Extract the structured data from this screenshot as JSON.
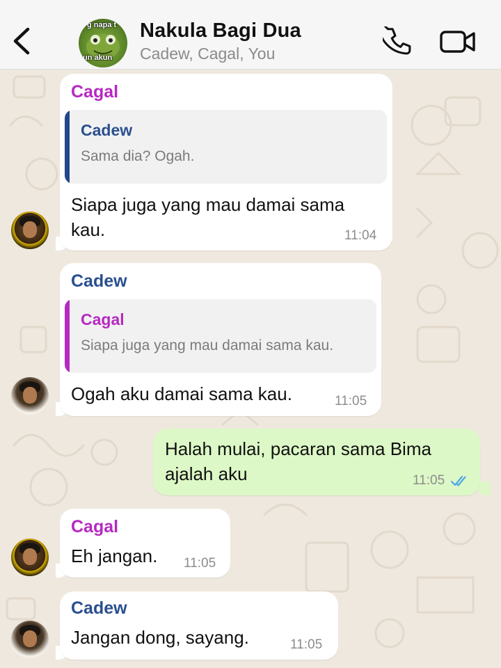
{
  "header": {
    "title": "Nakula Bagi Dua",
    "subtitle": "Cadew, Cagal, You",
    "avatar_text_top": "g napa t",
    "avatar_text_bottom": "un akun",
    "icons": [
      "back-chevron",
      "phone",
      "video-camera"
    ]
  },
  "colors": {
    "incoming_bubble": "#ffffff",
    "outgoing_bubble": "#dcf8c6",
    "cagal_name": "#b629c0",
    "cadew_name": "#2a4f8f",
    "read_ticks": "#4fa6e8"
  },
  "messages": [
    {
      "sender": "Cagal",
      "quote": {
        "name": "Cadew",
        "text": "Sama dia? Ogah."
      },
      "text_line1": "Siapa juga yang mau damai sama",
      "text_line2": "kau.",
      "time": "11:04"
    },
    {
      "sender": "Cadew",
      "quote": {
        "name": "Cagal",
        "text": "Siapa juga yang mau damai sama kau."
      },
      "text": "Ogah aku damai sama kau.",
      "time": "11:05"
    },
    {
      "sender": "You",
      "text_line1": "Halah mulai, pacaran sama Bima",
      "text_line2": "ajalah aku",
      "time": "11:05",
      "status": "read"
    },
    {
      "sender": "Cagal",
      "text": "Eh jangan.",
      "time": "11:05"
    },
    {
      "sender": "Cadew",
      "text": "Jangan dong, sayang.",
      "time": "11:05"
    }
  ]
}
